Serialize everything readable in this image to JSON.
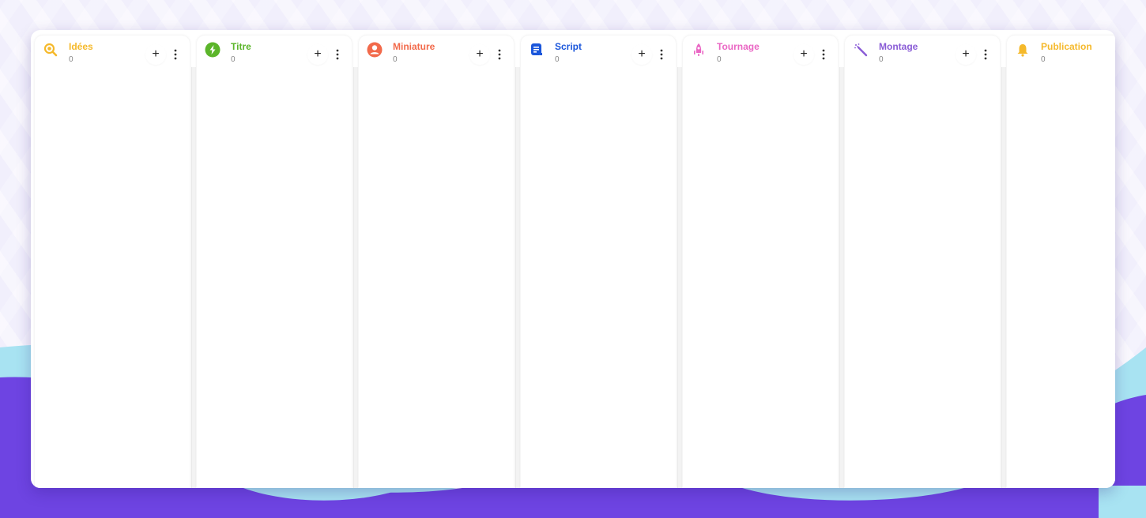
{
  "board": {
    "columns": [
      {
        "title": "Idées",
        "count": "0",
        "icon": "search-bulb-icon",
        "color": "#f5b92b"
      },
      {
        "title": "Titre",
        "count": "0",
        "icon": "lightning-icon",
        "color": "#5bb52a"
      },
      {
        "title": "Miniature",
        "count": "0",
        "icon": "account-circle-icon",
        "color": "#f26a4b"
      },
      {
        "title": "Script",
        "count": "0",
        "icon": "script-doc-icon",
        "color": "#1a56db"
      },
      {
        "title": "Tournage",
        "count": "0",
        "icon": "rocket-icon",
        "color": "#ea67c4"
      },
      {
        "title": "Montage",
        "count": "0",
        "icon": "magic-wand-icon",
        "color": "#8a5cd6"
      },
      {
        "title": "Publication",
        "count": "0",
        "icon": "bell-icon",
        "color": "#f5b92b"
      }
    ],
    "add_label": "+",
    "more_label": "⋮"
  },
  "theme": {
    "wave_light": "#a8e3f2",
    "wave_dark": "#6e44e2"
  }
}
